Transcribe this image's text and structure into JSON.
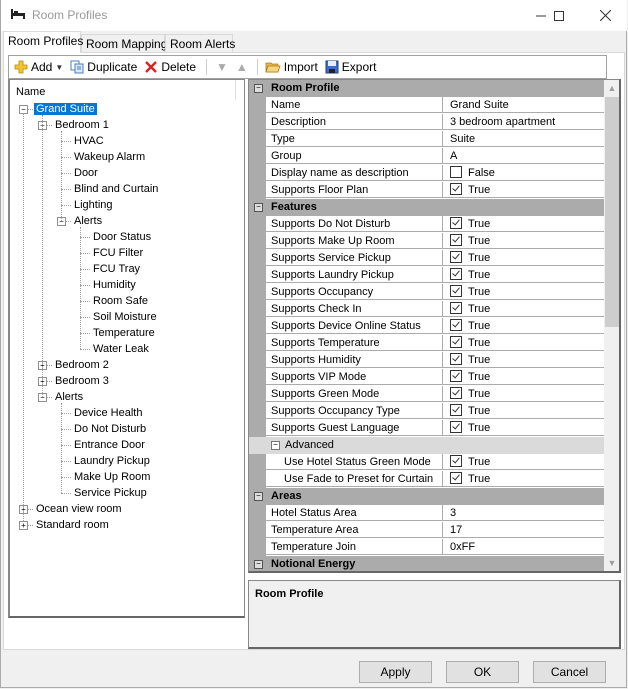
{
  "window": {
    "title": "Room Profiles",
    "controls": [
      "minimize",
      "maximize",
      "close"
    ]
  },
  "tabs": [
    {
      "label": "Room Profiles",
      "active": true
    },
    {
      "label": "Room Mapping",
      "active": false
    },
    {
      "label": "Room Alerts",
      "active": false
    }
  ],
  "toolbar": {
    "add": "Add",
    "duplicate": "Duplicate",
    "delete": "Delete",
    "move_down_icon": "triangle-down",
    "move_up_icon": "triangle-up",
    "import": "Import",
    "export": "Export"
  },
  "tree": {
    "header": "Name",
    "nodes": [
      {
        "label": "Grand Suite",
        "level": 0,
        "expander": "minus",
        "selected": true
      },
      {
        "label": "Bedroom 1",
        "level": 1,
        "expander": "minus"
      },
      {
        "label": "HVAC",
        "level": 2
      },
      {
        "label": "Wakeup Alarm",
        "level": 2
      },
      {
        "label": "Door",
        "level": 2
      },
      {
        "label": "Blind and Curtain",
        "level": 2
      },
      {
        "label": "Lighting",
        "level": 2
      },
      {
        "label": "Alerts",
        "level": 2,
        "expander": "minus"
      },
      {
        "label": "Door Status",
        "level": 3
      },
      {
        "label": "FCU Filter",
        "level": 3
      },
      {
        "label": "FCU Tray",
        "level": 3
      },
      {
        "label": "Humidity",
        "level": 3
      },
      {
        "label": "Room Safe",
        "level": 3
      },
      {
        "label": "Soil Moisture",
        "level": 3
      },
      {
        "label": "Temperature",
        "level": 3
      },
      {
        "label": "Water Leak",
        "level": 3
      },
      {
        "label": "Bedroom 2",
        "level": 1,
        "expander": "plus"
      },
      {
        "label": "Bedroom 3",
        "level": 1,
        "expander": "plus"
      },
      {
        "label": "Alerts",
        "level": 1,
        "expander": "minus"
      },
      {
        "label": "Device Health",
        "level": 2
      },
      {
        "label": "Do Not Disturb",
        "level": 2
      },
      {
        "label": "Entrance Door",
        "level": 2
      },
      {
        "label": "Laundry Pickup",
        "level": 2
      },
      {
        "label": "Make Up Room",
        "level": 2
      },
      {
        "label": "Service Pickup",
        "level": 2
      },
      {
        "label": "Ocean view room",
        "level": 0,
        "expander": "plus"
      },
      {
        "label": "Standard room",
        "level": 0,
        "expander": "plus"
      }
    ]
  },
  "grid": {
    "rows": [
      {
        "type": "category",
        "label": "Room Profile"
      },
      {
        "type": "prop",
        "name": "Name",
        "value": "Grand Suite"
      },
      {
        "type": "prop",
        "name": "Description",
        "value": "3 bedroom apartment"
      },
      {
        "type": "prop",
        "name": "Type",
        "value": "Suite"
      },
      {
        "type": "prop",
        "name": "Group",
        "value": "A"
      },
      {
        "type": "prop",
        "name": "Display name as description",
        "value": "False",
        "checkbox": true,
        "checked": false
      },
      {
        "type": "prop",
        "name": "Supports Floor Plan",
        "value": "True",
        "checkbox": true,
        "checked": true
      },
      {
        "type": "category",
        "label": "Features"
      },
      {
        "type": "prop",
        "name": "Supports Do Not Disturb",
        "value": "True",
        "checkbox": true,
        "checked": true
      },
      {
        "type": "prop",
        "name": "Supports Make Up Room",
        "value": "True",
        "checkbox": true,
        "checked": true
      },
      {
        "type": "prop",
        "name": "Supports Service Pickup",
        "value": "True",
        "checkbox": true,
        "checked": true
      },
      {
        "type": "prop",
        "name": "Supports Laundry Pickup",
        "value": "True",
        "checkbox": true,
        "checked": true
      },
      {
        "type": "prop",
        "name": "Supports Occupancy",
        "value": "True",
        "checkbox": true,
        "checked": true
      },
      {
        "type": "prop",
        "name": "Supports Check In",
        "value": "True",
        "checkbox": true,
        "checked": true
      },
      {
        "type": "prop",
        "name": "Supports Device Online Status",
        "value": "True",
        "checkbox": true,
        "checked": true
      },
      {
        "type": "prop",
        "name": "Supports Temperature",
        "value": "True",
        "checkbox": true,
        "checked": true
      },
      {
        "type": "prop",
        "name": "Supports Humidity",
        "value": "True",
        "checkbox": true,
        "checked": true
      },
      {
        "type": "prop",
        "name": "Supports VIP Mode",
        "value": "True",
        "checkbox": true,
        "checked": true
      },
      {
        "type": "prop",
        "name": "Supports Green Mode",
        "value": "True",
        "checkbox": true,
        "checked": true
      },
      {
        "type": "prop",
        "name": "Supports Occupancy Type",
        "value": "True",
        "checkbox": true,
        "checked": true
      },
      {
        "type": "prop",
        "name": "Supports Guest Language",
        "value": "True",
        "checkbox": true,
        "checked": true
      },
      {
        "type": "subcategory",
        "label": "Advanced"
      },
      {
        "type": "prop",
        "name": "Use Hotel Status Green Mode",
        "value": "True",
        "checkbox": true,
        "checked": true,
        "indent": true
      },
      {
        "type": "prop",
        "name": "Use Fade to Preset for Curtain",
        "value": "True",
        "checkbox": true,
        "checked": true,
        "indent": true
      },
      {
        "type": "category",
        "label": "Areas"
      },
      {
        "type": "prop",
        "name": "Hotel Status Area",
        "value": "3"
      },
      {
        "type": "prop",
        "name": "Temperature Area",
        "value": "17"
      },
      {
        "type": "prop",
        "name": "Temperature Join",
        "value": "0xFF"
      },
      {
        "type": "category",
        "label": "Notional Energy"
      }
    ]
  },
  "description_panel": {
    "title": "Room Profile"
  },
  "buttons": {
    "apply": "Apply",
    "ok": "OK",
    "cancel": "Cancel"
  },
  "colors": {
    "selection": "#0078d7",
    "category_bg": "#ababab",
    "subcategory_bg": "#dadada"
  }
}
